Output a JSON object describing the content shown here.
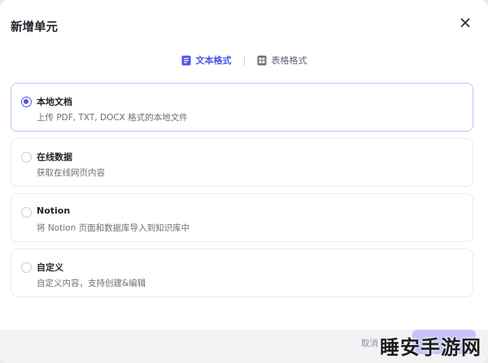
{
  "dialog": {
    "title": "新增单元",
    "close_icon": "close-icon"
  },
  "tabs": [
    {
      "label": "文本格式",
      "icon": "document-icon",
      "active": true
    },
    {
      "label": "表格格式",
      "icon": "table-icon",
      "active": false
    }
  ],
  "options": [
    {
      "title": "本地文档",
      "description": "上传 PDF, TXT, DOCX 格式的本地文件",
      "selected": true
    },
    {
      "title": "在线数据",
      "description": "获取在线网页内容",
      "selected": false
    },
    {
      "title": "Notion",
      "description": "将 Notion 页面和数据库导入到知识库中",
      "selected": false
    },
    {
      "title": "自定义",
      "description": "自定义内容，支持创建&编辑",
      "selected": false
    }
  ],
  "footer": {
    "cancel_label": "取消",
    "confirm_label": ""
  },
  "watermark": "睡安手游网",
  "colors": {
    "accent": "#4d53e8",
    "selected_border": "#c4c6f5",
    "confirm_disabled": "#c5c3f7"
  }
}
